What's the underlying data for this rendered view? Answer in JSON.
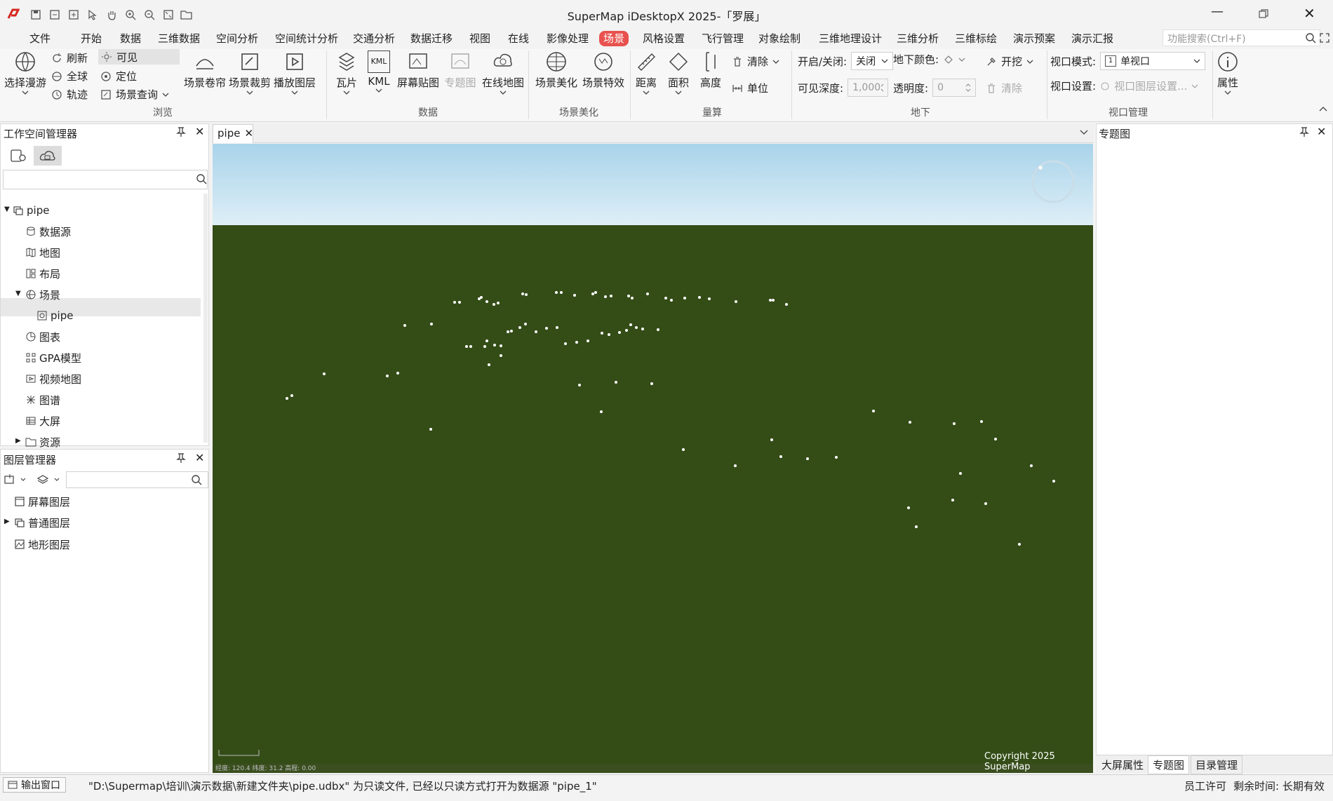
{
  "app": {
    "title": "SuperMap iDesktopX 2025-「罗展」"
  },
  "menu": [
    "文件",
    "开始",
    "数据",
    "三维数据",
    "空间分析",
    "空间统计分析",
    "交通分析",
    "数据迁移",
    "视图",
    "在线",
    "影像处理",
    "场景",
    "风格设置",
    "飞行管理",
    "对象绘制",
    "三维地理设计",
    "三维分析",
    "三维标绘",
    "演示预案",
    "演示汇报"
  ],
  "menu_active": "场景",
  "search": {
    "placeholder": "功能搜索(Ctrl+F)"
  },
  "ribbon": {
    "browse": {
      "select_roam": "选择漫游",
      "refresh": "刷新",
      "visible": "可见",
      "globe": "全球",
      "locate": "定位",
      "track": "轨迹",
      "scene_query": "场景查询",
      "scene_roll": "场景卷帘",
      "scene_clip": "场景裁剪",
      "play_layer": "播放图层",
      "group": "浏览"
    },
    "data": {
      "tile": "瓦片",
      "kml": "KML",
      "kml_icon": "KML",
      "screen_texture": "屏幕贴图",
      "thematic_map": "专题图",
      "online_map": "在线地图",
      "group": "数据"
    },
    "beautify": {
      "scene_beautify": "场景美化",
      "scene_effect": "场景特效",
      "group": "场景美化"
    },
    "measure": {
      "distance": "距离",
      "area": "面积",
      "height": "高度",
      "clear": "清除",
      "unit": "单位",
      "group": "量算"
    },
    "underground": {
      "toggle_label": "开启/关闭:",
      "toggle_value": "关闭",
      "color_label": "地下颜色:",
      "dig": "开挖",
      "depth_label": "可见深度:",
      "depth_value": "1,000",
      "opacity_label": "透明度:",
      "opacity_value": "0",
      "clear": "清除",
      "group": "地下"
    },
    "viewport": {
      "mode_label": "视口模式:",
      "mode_badge": "1",
      "mode_value": "单视口",
      "setting_label": "视口设置:",
      "setting_value": "视口图层设置...",
      "group": "视口管理"
    },
    "properties": "属性"
  },
  "workspace_panel": {
    "title": "工作空间管理器",
    "tree": [
      {
        "label": "pipe",
        "level": 0,
        "icon": "workspace-icon",
        "expanded": true
      },
      {
        "label": "数据源",
        "level": 1,
        "icon": "datasource-icon"
      },
      {
        "label": "地图",
        "level": 1,
        "icon": "map-icon"
      },
      {
        "label": "布局",
        "level": 1,
        "icon": "layout-icon"
      },
      {
        "label": "场景",
        "level": 1,
        "icon": "scene-icon",
        "expanded": true
      },
      {
        "label": "pipe",
        "level": 2,
        "icon": "scene-item-icon",
        "selected": true
      },
      {
        "label": "图表",
        "level": 1,
        "icon": "chart-icon"
      },
      {
        "label": "GPA模型",
        "level": 1,
        "icon": "gpa-icon"
      },
      {
        "label": "视频地图",
        "level": 1,
        "icon": "video-map-icon"
      },
      {
        "label": "图谱",
        "level": 1,
        "icon": "graph-icon"
      },
      {
        "label": "大屏",
        "level": 1,
        "icon": "bigscreen-icon"
      },
      {
        "label": "资源",
        "level": 1,
        "icon": "resource-folder-icon",
        "collapsed": true
      }
    ]
  },
  "layer_panel": {
    "title": "图层管理器",
    "items": [
      "屏幕图层",
      "普通图层",
      "地形图层"
    ]
  },
  "document_tab": {
    "label": "pipe"
  },
  "viewport": {
    "copyright": "Copyright 2025 SuperMap",
    "status_coords": "经度: 120.4 纬度: 31.2  高程: 0.00"
  },
  "right_panel": {
    "title": "专题图",
    "tabs": [
      "大屏属性",
      "专题图",
      "目录管理"
    ]
  },
  "statusbar": {
    "output_window": "输出窗口",
    "message": "\"D:\\Supermap\\培训\\演示数据\\新建文件夹\\pipe.udbx\" 为只读文件, 已经以只读方式打开为数据源 \"pipe_1\"",
    "license": "员工许可",
    "remaining": "剩余时间: 长期有效"
  }
}
